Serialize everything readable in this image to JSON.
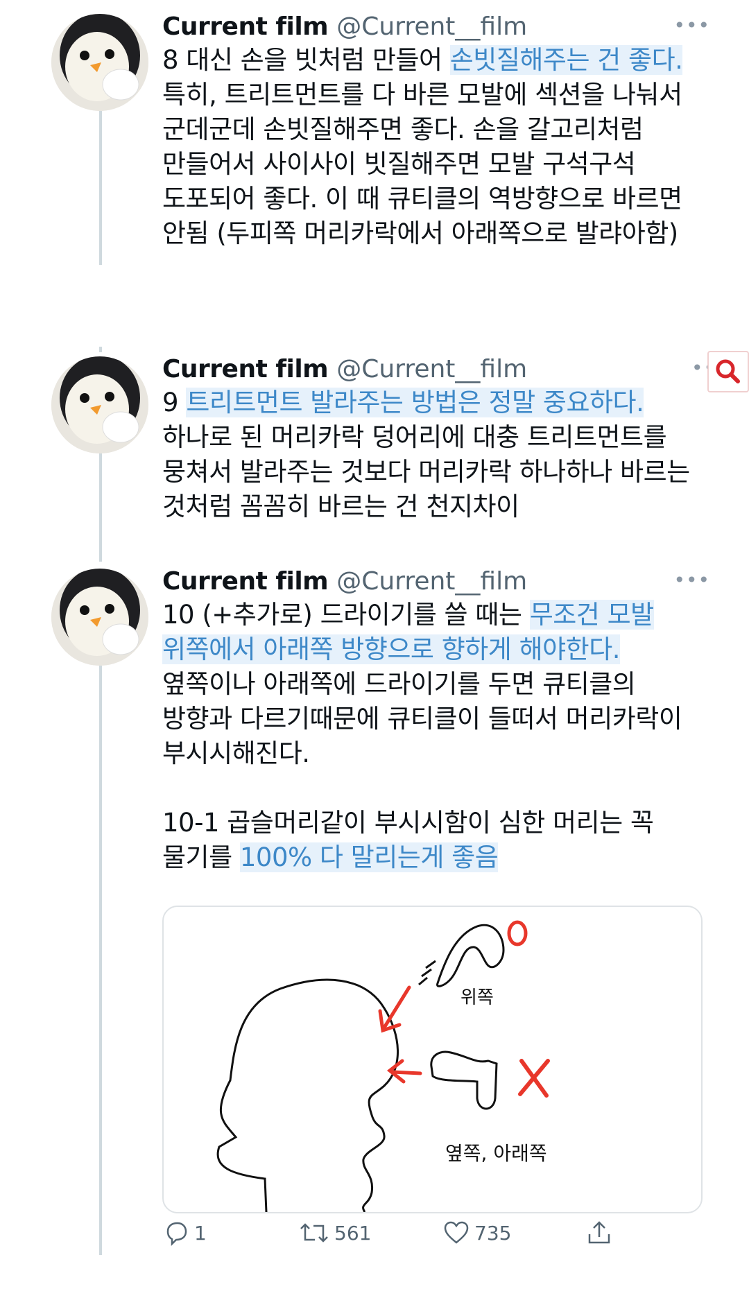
{
  "colors": {
    "accent": "#3d88c8",
    "highlight": "#e6f1fb",
    "thread_line": "#cfd9de",
    "red_marks": "#e8372b"
  },
  "tweets": [
    {
      "name": "Current film",
      "handle": "@Current__film",
      "text_parts": [
        {
          "t": "8 대신 손을 빗처럼 만들어 ",
          "h": false
        },
        {
          "t": "손빗질해주는 건 좋다.",
          "h": true
        },
        {
          "t": " 특히, 트리트먼트를 다 바른 모발에 섹션을 나눠서 군데군데 손빗질해주면 좋다. 손을 갈고리처럼 만들어서 사이사이 빗질해주면 모발 구석구석 도포되어 좋다. 이 때 큐티클의 역방향으로 바르면 안됨 (두피쪽 머리카락에서 아래쪽으로 발랴아함)",
          "h": false
        }
      ]
    },
    {
      "name": "Current film",
      "handle": "@Current__film",
      "text_parts": [
        {
          "t": "9 ",
          "h": false
        },
        {
          "t": "트리트먼트 발라주는 방법은 정말 중요하다.",
          "h": true
        },
        {
          "t": " 하나로 된 머리카락 덩어리에 대충 트리트먼트를 뭉쳐서 발라주는 것보다 머리카락 하나하나 바르는 것처럼 꼼꼼히 바르는 건 천지차이",
          "h": false
        }
      ]
    },
    {
      "name": "Current film",
      "handle": "@Current__film",
      "text_parts": [
        {
          "t": "10 (+추가로) 드라이기를 쓸 때는 ",
          "h": false
        },
        {
          "t": "무조건 모발 위쪽에서 아래쪽 방향으로 향하게 해야한다.",
          "h": true
        },
        {
          "t": " 옆쪽이나 아래쪽에 드라이기를 두면 큐티클의 방향과 다르기때문에 큐티클이 들떠서 머리카락이 부시시해진다.",
          "h": false
        }
      ],
      "text2_parts": [
        {
          "t": "10-1 곱슬머리같이 부시시함이 심한 머리는 꼭 물기를 ",
          "h": false
        },
        {
          "t": "100% 다 말리는게 좋음",
          "h": true
        }
      ]
    }
  ],
  "diagram": {
    "label_top": "위쪽",
    "label_side": "옆쪽, 아래쪽",
    "mark_ok": "O",
    "mark_bad": "X"
  },
  "actions": {
    "replies": "1",
    "retweets": "561",
    "likes": "735"
  },
  "icons": [
    "more-icon",
    "search-icon",
    "reply-icon",
    "retweet-icon",
    "like-icon",
    "share-icon"
  ]
}
